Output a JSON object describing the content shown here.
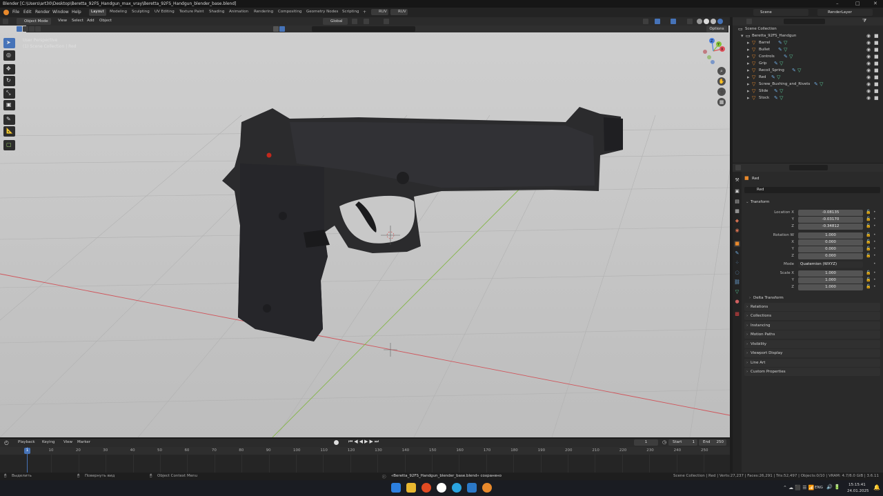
{
  "window": {
    "title": "Blender [C:\\Users\\art30\\Desktop\\Beretta_92FS_Handgun_max_vray\\Beretta_92FS_Handgun_blender_base.blend]",
    "controls": [
      "–",
      "□",
      "✕"
    ]
  },
  "menubar": {
    "menus": [
      "File",
      "Edit",
      "Render",
      "Window",
      "Help"
    ],
    "workspaces": [
      "Layout",
      "Modeling",
      "Sculpting",
      "UV Editing",
      "Texture Paint",
      "Shading",
      "Animation",
      "Rendering",
      "Compositing",
      "Geometry Nodes",
      "Scripting"
    ],
    "active_workspace": "Layout",
    "add_tab": "+",
    "ruv_buttons": [
      "RUV",
      "RUV"
    ],
    "scene_label": "Scene",
    "layer_label": "RenderLayer"
  },
  "viewport_header": {
    "mode": "Object Mode",
    "menus": [
      "View",
      "Select",
      "Add",
      "Object"
    ],
    "orientation": "Global",
    "options": "Options"
  },
  "viewport": {
    "view_name": "User Perspective",
    "collection_info": "(1) Scene Collection | Red",
    "gizmo_axes": {
      "x": "X",
      "y": "Y",
      "z": "Z"
    }
  },
  "outliner": {
    "root": "Scene Collection",
    "collection": "Beretta_92FS_Handgun",
    "objects": [
      "Barrel",
      "Bullet",
      "Controls",
      "Grip",
      "Recoil_Spring",
      "Red",
      "Screw_Bushing_and_Rivets",
      "Slide",
      "Stock"
    ],
    "selected": "Red"
  },
  "properties": {
    "object_name": "Red",
    "object_field": "Red",
    "transform_title": "Transform",
    "location": {
      "label": "Location X",
      "x": "-0.08135",
      "y": "-0.03170",
      "z": "-0.34812"
    },
    "rotation": {
      "label": "Rotation W",
      "w": "1.000",
      "x": "0.000",
      "y": "0.000",
      "z": "0.000"
    },
    "mode": {
      "label": "Mode",
      "value": "Quaternion (WXYZ)"
    },
    "scale": {
      "label": "Scale X",
      "x": "1.000",
      "y": "1.000",
      "z": "1.000"
    },
    "axis_labels": {
      "y": "Y",
      "z": "Z",
      "x": "X"
    },
    "delta_transform": "Delta Transform",
    "panels": [
      "Relations",
      "Collections",
      "Instancing",
      "Motion Paths",
      "Visibility",
      "Viewport Display",
      "Line Art",
      "Custom Properties"
    ]
  },
  "timeline": {
    "menus": [
      "Playback",
      "Keying",
      "View",
      "Marker"
    ],
    "current_frame": "1",
    "start_label": "Start",
    "start": "1",
    "end_label": "End",
    "end": "250",
    "ticks": [
      "1",
      "10",
      "20",
      "30",
      "40",
      "50",
      "60",
      "70",
      "80",
      "90",
      "100",
      "110",
      "120",
      "130",
      "140",
      "150",
      "160",
      "170",
      "180",
      "190",
      "200",
      "210",
      "220",
      "230",
      "240",
      "250"
    ]
  },
  "statusbar": {
    "left1": "Выделить",
    "left2": "Повернуть вид",
    "left3": "Object Context Menu",
    "message": "«Beretta_92FS_Handgun_blender_base.blend» сохранено",
    "stats": "Scene Collection | Red | Verts:27,237 | Faces:26,291 | Tris:52,497 | Objects:0/10 | VRAM: 4.7/8.0 GiB | 3.6.11"
  },
  "taskbar": {
    "language": "ENG",
    "time": "15:15:41",
    "date": "24.01.2025"
  },
  "colors": {
    "accent": "#4673b8",
    "x_axis": "#e0505a",
    "y_axis": "#84c23a",
    "z_axis": "#4a7ee0",
    "object_orange": "#e8892c"
  }
}
